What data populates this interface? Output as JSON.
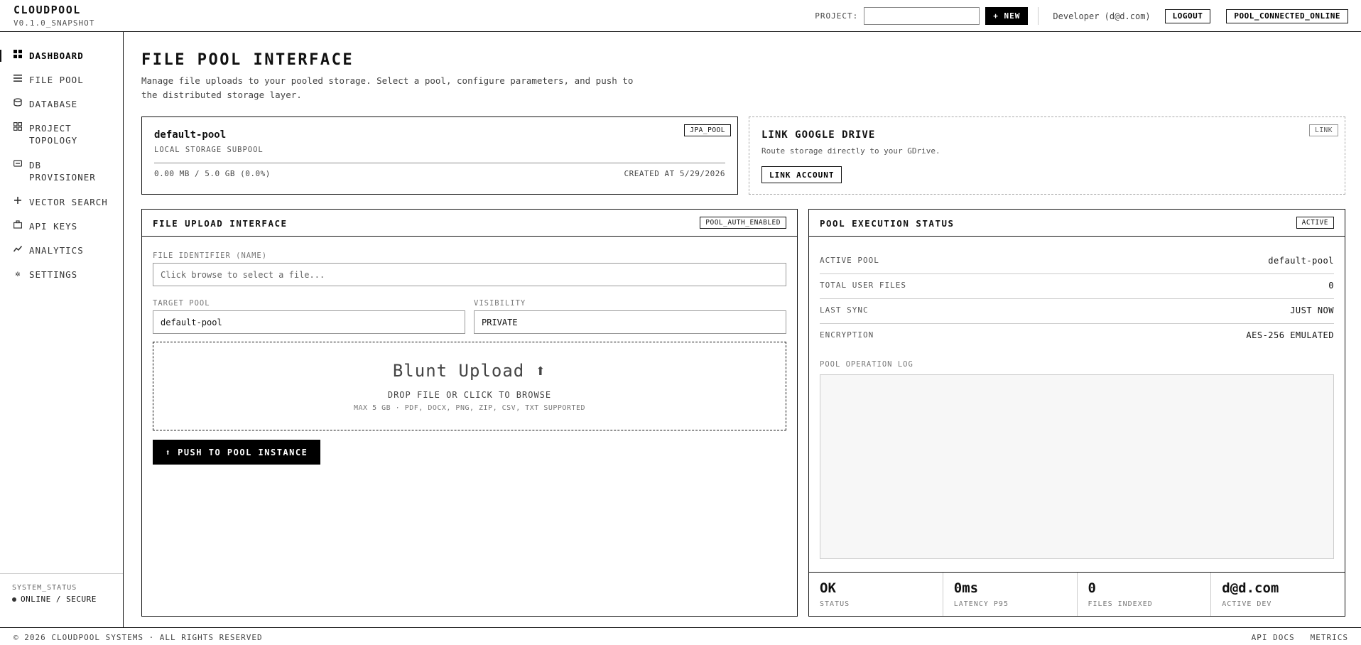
{
  "header": {
    "app_name": "CLOUDPOOL",
    "version": "V0.1.0_SNAPSHOT",
    "project_label": "PROJECT:",
    "project_value": "",
    "new_button": "+ NEW",
    "user": "Developer (d@d.com)",
    "logout": "LOGOUT",
    "connection_status": "POOL_CONNECTED_ONLINE"
  },
  "sidebar": {
    "items": [
      {
        "label": "DASHBOARD",
        "icon": "grid-icon",
        "active": true
      },
      {
        "label": "FILE POOL",
        "icon": "list-icon"
      },
      {
        "label": "DATABASE",
        "icon": "database-icon"
      },
      {
        "label": "PROJECT\nTOPOLOGY",
        "icon": "topology-icon"
      },
      {
        "label": "DB\nPROVISIONER",
        "icon": "server-icon"
      },
      {
        "label": "VECTOR SEARCH",
        "icon": "plus-icon"
      },
      {
        "label": "API KEYS",
        "icon": "briefcase-icon"
      },
      {
        "label": "ANALYTICS",
        "icon": "trend-icon"
      },
      {
        "label": "SETTINGS",
        "icon": "gear-icon"
      }
    ],
    "system_status_label": "SYSTEM_STATUS",
    "system_status_value": "ONLINE / SECURE"
  },
  "page": {
    "title": "FILE POOL INTERFACE",
    "description": "Manage file uploads to your pooled storage. Select a pool, configure parameters, and push to the distributed storage layer."
  },
  "pool_card": {
    "name": "default-pool",
    "subtitle": "LOCAL STORAGE SUBPOOL",
    "tag": "JPA_POOL",
    "usage_text": "0.00 MB / 5.0 GB (0.0%)",
    "usage_fraction": 0.0,
    "created": "CREATED AT 5/29/2026"
  },
  "gdrive_card": {
    "title": "LINK GOOGLE DRIVE",
    "description": "Route storage directly to your GDrive.",
    "button": "LINK ACCOUNT",
    "tag": "LINK"
  },
  "upload_panel": {
    "title": "FILE UPLOAD INTERFACE",
    "tag": "POOL_AUTH_ENABLED",
    "file_label": "FILE IDENTIFIER (NAME)",
    "file_placeholder": "Click browse to select a file...",
    "target_label": "TARGET POOL",
    "target_value": "default-pool",
    "visibility_label": "VISIBILITY",
    "visibility_value": "PRIVATE",
    "drop_title": "Blunt Upload ⬆",
    "drop_sub": "DROP FILE OR CLICK TO BROWSE",
    "drop_hint": "MAX 5 GB · PDF, DOCX, PNG, ZIP, CSV, TXT SUPPORTED",
    "push_button": "⬆ PUSH TO POOL INSTANCE"
  },
  "status_panel": {
    "title": "POOL EXECUTION STATUS",
    "tag": "ACTIVE",
    "rows": [
      {
        "key": "ACTIVE POOL",
        "value": "default-pool"
      },
      {
        "key": "TOTAL USER FILES",
        "value": "0"
      },
      {
        "key": "LAST SYNC",
        "value": "JUST NOW"
      },
      {
        "key": "ENCRYPTION",
        "value": "AES-256 EMULATED"
      }
    ],
    "log_label": "POOL OPERATION LOG",
    "metrics": [
      {
        "value": "OK",
        "label": "STATUS"
      },
      {
        "value": "0ms",
        "label": "LATENCY P95"
      },
      {
        "value": "0",
        "label": "FILES INDEXED"
      },
      {
        "value": "d@d.com",
        "label": "ACTIVE DEV"
      }
    ]
  },
  "footer": {
    "copyright": "© 2026 CLOUDPOOL SYSTEMS · ALL RIGHTS RESERVED",
    "links": [
      "API DOCS",
      "METRICS"
    ]
  }
}
